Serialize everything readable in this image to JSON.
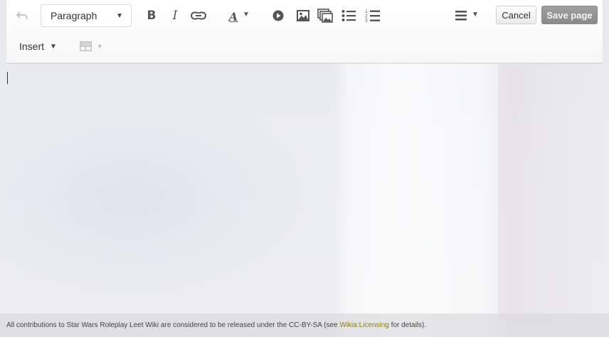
{
  "toolbar": {
    "format_select": {
      "value": "Paragraph"
    },
    "bold_label": "B",
    "italic_label": "I",
    "style_label": "A",
    "cancel_label": "Cancel",
    "save_label": "Save page",
    "insert_label": "Insert"
  },
  "footer": {
    "text_before": "All contributions to Star Wars Roleplay Leet Wiki are considered to be released under the CC-BY-SA (see ",
    "link_text": "Wikia:Licensing",
    "text_after": " for details)."
  },
  "icons": [
    "undo-icon",
    "link-icon",
    "video-icon",
    "image-icon",
    "gallery-icon",
    "bullet-list-icon",
    "numbered-list-icon",
    "align-icon",
    "table-icon"
  ],
  "colors": {
    "save_bg": "#8a8a8a",
    "link": "#8a7a18"
  }
}
